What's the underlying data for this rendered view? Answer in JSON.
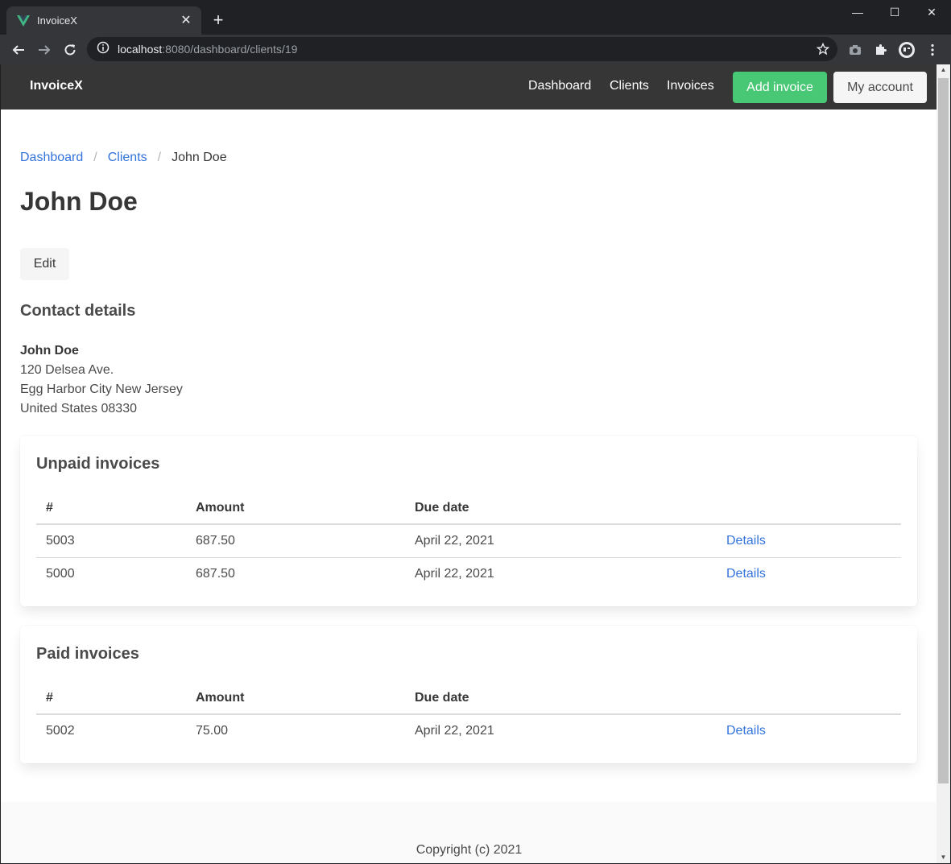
{
  "browser": {
    "tab_title": "InvoiceX",
    "url_host": "localhost",
    "url_path": ":8080/dashboard/clients/19"
  },
  "navbar": {
    "brand": "InvoiceX",
    "links": [
      "Dashboard",
      "Clients",
      "Invoices"
    ],
    "add_invoice": "Add invoice",
    "my_account": "My account"
  },
  "breadcrumb": {
    "items": [
      "Dashboard",
      "Clients"
    ],
    "current": "John Doe",
    "separator": "/"
  },
  "page": {
    "title": "John Doe",
    "edit_label": "Edit",
    "contact_heading": "Contact details"
  },
  "contact": {
    "name": "John Doe",
    "address1": "120 Delsea Ave.",
    "address2": "Egg Harbor City New Jersey",
    "address3": "United States 08330"
  },
  "table_headers": {
    "number": "#",
    "amount": "Amount",
    "due_date": "Due date"
  },
  "unpaid": {
    "title": "Unpaid invoices",
    "rows": [
      {
        "number": "5003",
        "amount": "687.50",
        "due": "April 22, 2021",
        "action": "Details"
      },
      {
        "number": "5000",
        "amount": "687.50",
        "due": "April 22, 2021",
        "action": "Details"
      }
    ]
  },
  "paid": {
    "title": "Paid invoices",
    "rows": [
      {
        "number": "5002",
        "amount": "75.00",
        "due": "April 22, 2021",
        "action": "Details"
      }
    ]
  },
  "footer": {
    "text": "Copyright (c) 2021"
  },
  "colors": {
    "primary_link": "#3273dc",
    "success": "#48c774",
    "navbar": "#363636"
  },
  "icons": [
    "vue-favicon-icon",
    "close-icon",
    "plus-icon",
    "minimize-icon",
    "maximize-icon",
    "window-close-icon",
    "back-arrow-icon",
    "forward-arrow-icon",
    "reload-icon",
    "info-icon",
    "star-icon",
    "camera-icon",
    "puzzle-icon",
    "profile-icon",
    "menu-dots-icon"
  ]
}
